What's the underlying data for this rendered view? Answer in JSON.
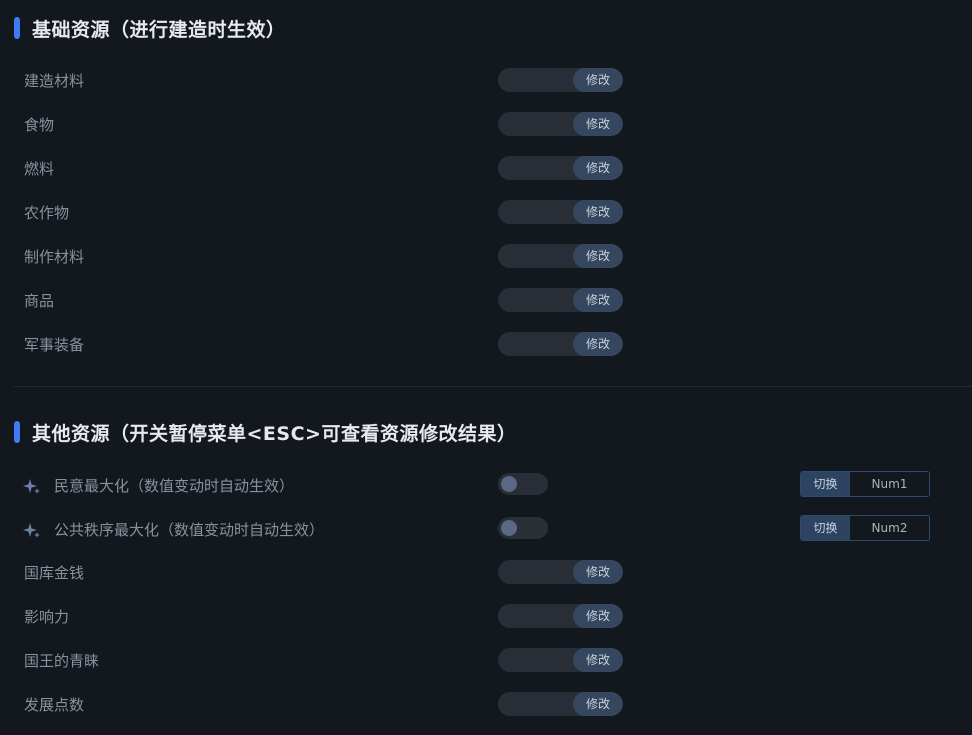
{
  "section1": {
    "title": "基础资源（进行建造时生效）",
    "edit_label": "修改",
    "items": [
      {
        "label": "建造材料"
      },
      {
        "label": "食物"
      },
      {
        "label": "燃料"
      },
      {
        "label": "农作物"
      },
      {
        "label": "制作材料"
      },
      {
        "label": "商品"
      },
      {
        "label": "军事装备"
      }
    ]
  },
  "section2": {
    "title": "其他资源（开关暂停菜单<ESC>可查看资源修改结果）",
    "edit_label": "修改",
    "toggles": [
      {
        "label": "民意最大化（数值变动时自动生效）",
        "switch_label": "切换",
        "hotkey": "Num1"
      },
      {
        "label": "公共秩序最大化（数值变动时自动生效）",
        "switch_label": "切换",
        "hotkey": "Num2"
      }
    ],
    "items": [
      {
        "label": "国库金钱"
      },
      {
        "label": "影响力"
      },
      {
        "label": "国王的青睐"
      },
      {
        "label": "发展点数"
      }
    ]
  },
  "colors": {
    "background": "#13171e",
    "accent": "#3f7cf2",
    "edit_button": "#34475e",
    "track": "#2a2f37",
    "knob": "#5a6785"
  },
  "icons": {
    "toggle_row_icon": "sparkle-icon"
  }
}
